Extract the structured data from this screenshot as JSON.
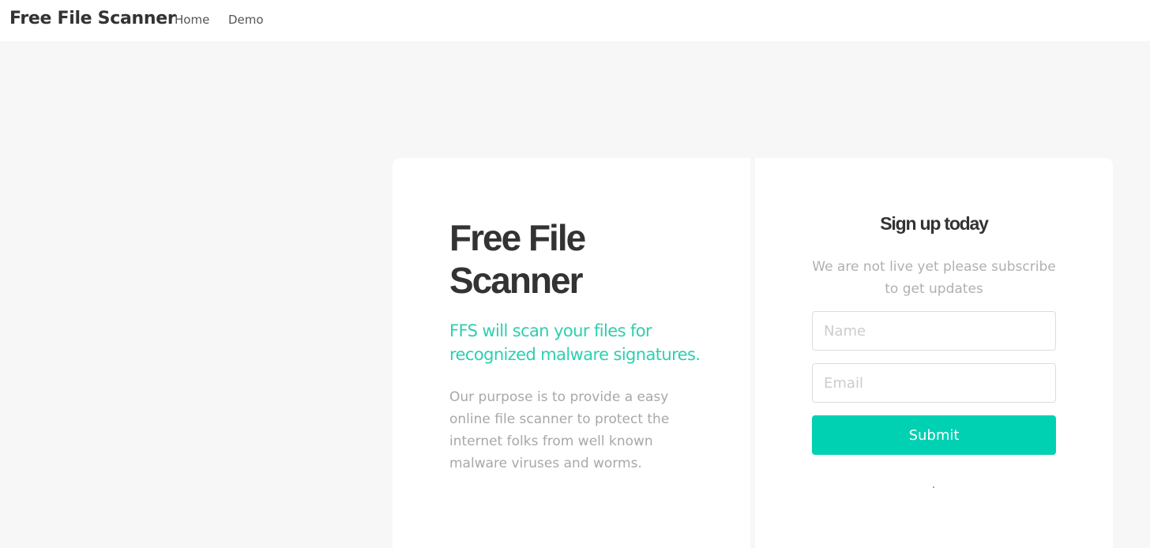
{
  "navbar": {
    "brand": "Free File Scanner",
    "links": [
      {
        "label": "Home"
      },
      {
        "label": "Demo"
      }
    ]
  },
  "hero": {
    "title": "Free File Scanner",
    "tagline": "FFS will scan your files for recognized malware signatures.",
    "description": "Our purpose is to provide a easy online file scanner to protect the internet folks from well known malware viruses and worms."
  },
  "signup": {
    "title": "Sign up today",
    "subtitle": "We are not live yet please subscribe to get updates",
    "name_placeholder": "Name",
    "email_placeholder": "Email",
    "submit_label": "Submit"
  },
  "colors": {
    "accent": "#00d1b2",
    "tagline": "#2ecfaf",
    "background": "#f7f7f7",
    "text_dark": "#333333",
    "text_muted": "#a8a8a8"
  }
}
